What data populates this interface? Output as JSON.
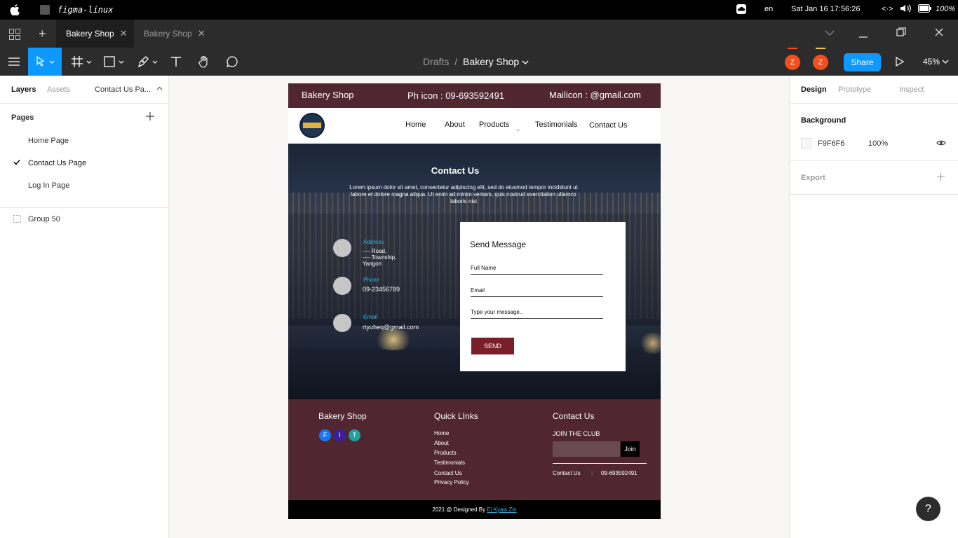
{
  "os": {
    "app_name": "figma-linux",
    "lang": "en",
    "datetime": "Sat Jan 16  17:56:26",
    "battery": "100%"
  },
  "tabs": [
    {
      "label": "Bakery Shop"
    },
    {
      "label": "Bakery Shop"
    }
  ],
  "toolbar": {
    "crumb_root": "Drafts",
    "crumb_sep": "/",
    "crumb_file": "Bakery Shop",
    "avatar1": "Z",
    "avatar2": "Z",
    "share": "Share",
    "zoom": "45%"
  },
  "left": {
    "tab_layers": "Layers",
    "tab_assets": "Assets",
    "tab_page": "Contact Us Pa...",
    "pages_heading": "Pages",
    "pages": [
      "Home Page",
      "Contact Us Page",
      "Log In Page"
    ],
    "layer": "Group 50"
  },
  "right": {
    "tab_design": "Design",
    "tab_prototype": "Prototype",
    "tab_inspect": "Inspect",
    "background_heading": "Background",
    "bg_hex": "F9F6F6",
    "bg_opacity": "100%",
    "export_heading": "Export"
  },
  "site": {
    "top_brand": "Bakery Shop",
    "top_phone": "Ph icon : 09-693592491",
    "top_mail": "Mailicon : @gmail.com",
    "nav": [
      "Home",
      "About",
      "Products",
      "Testimonials",
      "Contact Us"
    ],
    "hero_title": "Contact Us",
    "hero_text": "Lorem ipsum dolor sit amet, consectetur adipiscing elit, sed do eiusmod tempor incididunt ut labore et dolore magna aliqua. Ut enim ad minim veniam, quis nostrud exercitation ullamco laboris nisi",
    "address_label": "Address",
    "address_lines": [
      "---- Road,",
      "---- Township,",
      "Yangon"
    ],
    "phone_label": "Phone",
    "phone_value": "09-23456789",
    "email_label": "Email",
    "email_value": "rtyuheq@gmail.com",
    "form_title": "Send Message",
    "form_fields": [
      "Full Name",
      "Email",
      "Type your message.."
    ],
    "send": "SEND",
    "footer_brand": "Bakery Shop",
    "social": [
      "F",
      "I",
      "T"
    ],
    "quicklinks_heading": "Quick LInks",
    "quicklinks": [
      "Home",
      "About",
      "Products",
      "Testimonials",
      "Contact Us",
      "Privacy Policy"
    ],
    "contact_heading": "Contact Us",
    "club": "JOIN THE CLUB",
    "join": "Join",
    "contact_label": "Contact Us",
    "contact_colon": ":",
    "contact_phone": "09-693592491",
    "copyright_prefix": "2021 @ Designed By ",
    "copyright_author": "Ei Kyaw Zin"
  },
  "colors": {
    "maroon": "#502730",
    "accent": "#0d99ff",
    "send_button": "#7a1f28",
    "link_cyan": "#2fb2d8"
  },
  "help": "?"
}
